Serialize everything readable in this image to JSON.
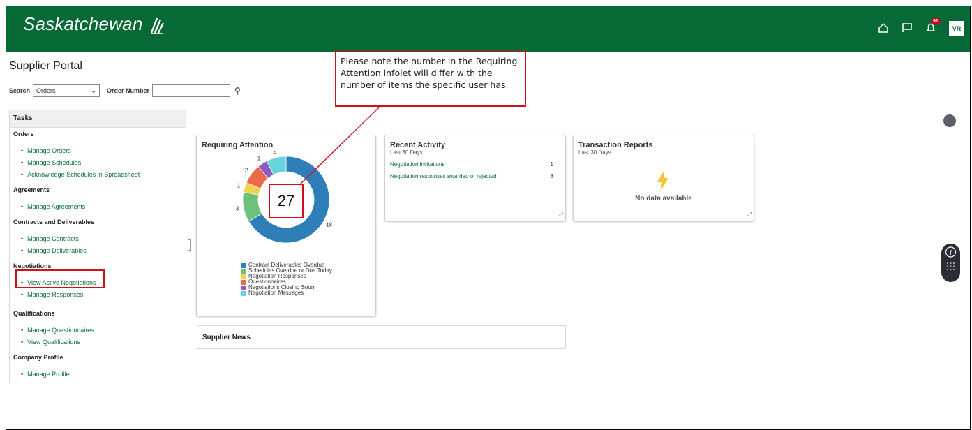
{
  "header": {
    "logo_text": "Saskatchewan",
    "notification_count": "91",
    "avatar_initials": "VR",
    "brand_color": "#076a36"
  },
  "page": {
    "title": "Supplier Portal"
  },
  "search": {
    "label": "Search",
    "selected": "Orders",
    "order_number_label": "Order Number",
    "order_number_value": ""
  },
  "tasks": {
    "title": "Tasks",
    "sections": [
      {
        "label": "Orders",
        "links": [
          "Manage Orders",
          "Manage Schedules",
          "Acknowledge Schedules in Spreadsheet"
        ]
      },
      {
        "label": "Agreements",
        "links": [
          "Manage Agreements"
        ]
      },
      {
        "label": "Contracts and Deliverables",
        "links": [
          "Manage Contracts",
          "Manage Deliverables"
        ]
      },
      {
        "label": "Negotiations",
        "links": [
          "View Active Negotiations",
          "Manage Responses"
        ]
      },
      {
        "label": "Qualifications",
        "links": [
          "Manage Questionnaires",
          "View Qualifications"
        ]
      },
      {
        "label": "Company Profile",
        "links": [
          "Manage Profile"
        ]
      }
    ]
  },
  "requiring_attention": {
    "title": "Requiring Attention",
    "total": "27",
    "segments": [
      {
        "name": "Contract Deliverables Overdue",
        "value": 18,
        "color": "#2e7fb8"
      },
      {
        "name": "Schedules Overdue or Due Today",
        "value": 3,
        "color": "#6cc07a"
      },
      {
        "name": "Negotiation Responses",
        "value": 1,
        "color": "#f3d34d"
      },
      {
        "name": "Questionnaires",
        "value": 2,
        "color": "#ea6a4a"
      },
      {
        "name": "Negotiations Closing Soon",
        "value": 1,
        "color": "#8c5cc2"
      },
      {
        "name": "Negotiation Messages",
        "value": 2,
        "color": "#66d4dc"
      }
    ]
  },
  "recent_activity": {
    "title": "Recent Activity",
    "subtitle": "Last 30 Days",
    "rows": [
      {
        "label": "Negotiation invitations",
        "count": "1"
      },
      {
        "label": "Negotiation responses awarded or rejected",
        "count": "8"
      }
    ]
  },
  "transaction_reports": {
    "title": "Transaction Reports",
    "subtitle": "Last 30 Days",
    "empty_text": "No data available"
  },
  "supplier_news": {
    "title": "Supplier News"
  },
  "callout": {
    "text": "Please note the number in the Requiring Attention infolet will differ with the number of items the specific user has."
  }
}
